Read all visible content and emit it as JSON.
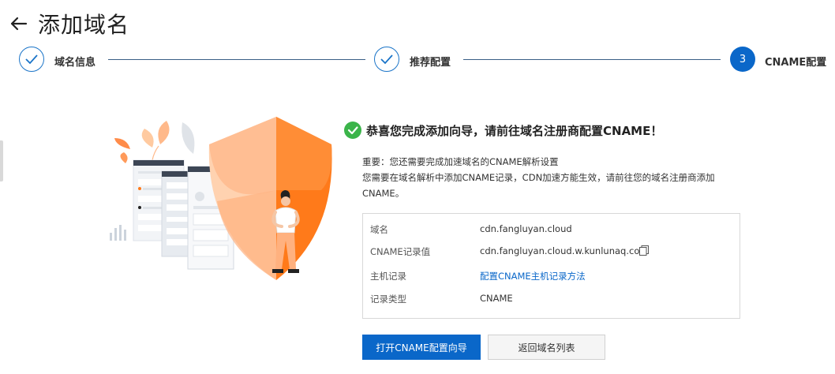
{
  "header": {
    "title": "添加域名",
    "back_icon": "arrow-left-icon"
  },
  "steps": [
    {
      "label": "域名信息",
      "status": "done"
    },
    {
      "label": "推荐配置",
      "status": "done"
    },
    {
      "label": "CNAME配置",
      "status": "active",
      "number": "3"
    }
  ],
  "result": {
    "title": "恭喜您完成添加向导，请前往域名注册商配置CNAME！",
    "desc_line1": "重要：您还需要完成加速域名的CNAME解析设置",
    "desc_line2": "您需要在域名解析中添加CNAME记录，CDN加速方能生效，请前往您的域名注册商添加",
    "desc_line3": "CNAME。"
  },
  "info": {
    "domain_label": "域名",
    "domain_value": "cdn.fangluyan.cloud",
    "cname_label": "CNAME记录值",
    "cname_value": "cdn.fangluyan.cloud.w.kunlunaq.com",
    "host_label": "主机记录",
    "host_link": "配置CNAME主机记录方法",
    "type_label": "记录类型",
    "type_value": "CNAME"
  },
  "buttons": {
    "primary": "打开CNAME配置向导",
    "secondary": "返回域名列表"
  },
  "colors": {
    "primary": "#0a67c9",
    "success": "#3bb44a",
    "accent_orange": "#ff7a1a"
  }
}
